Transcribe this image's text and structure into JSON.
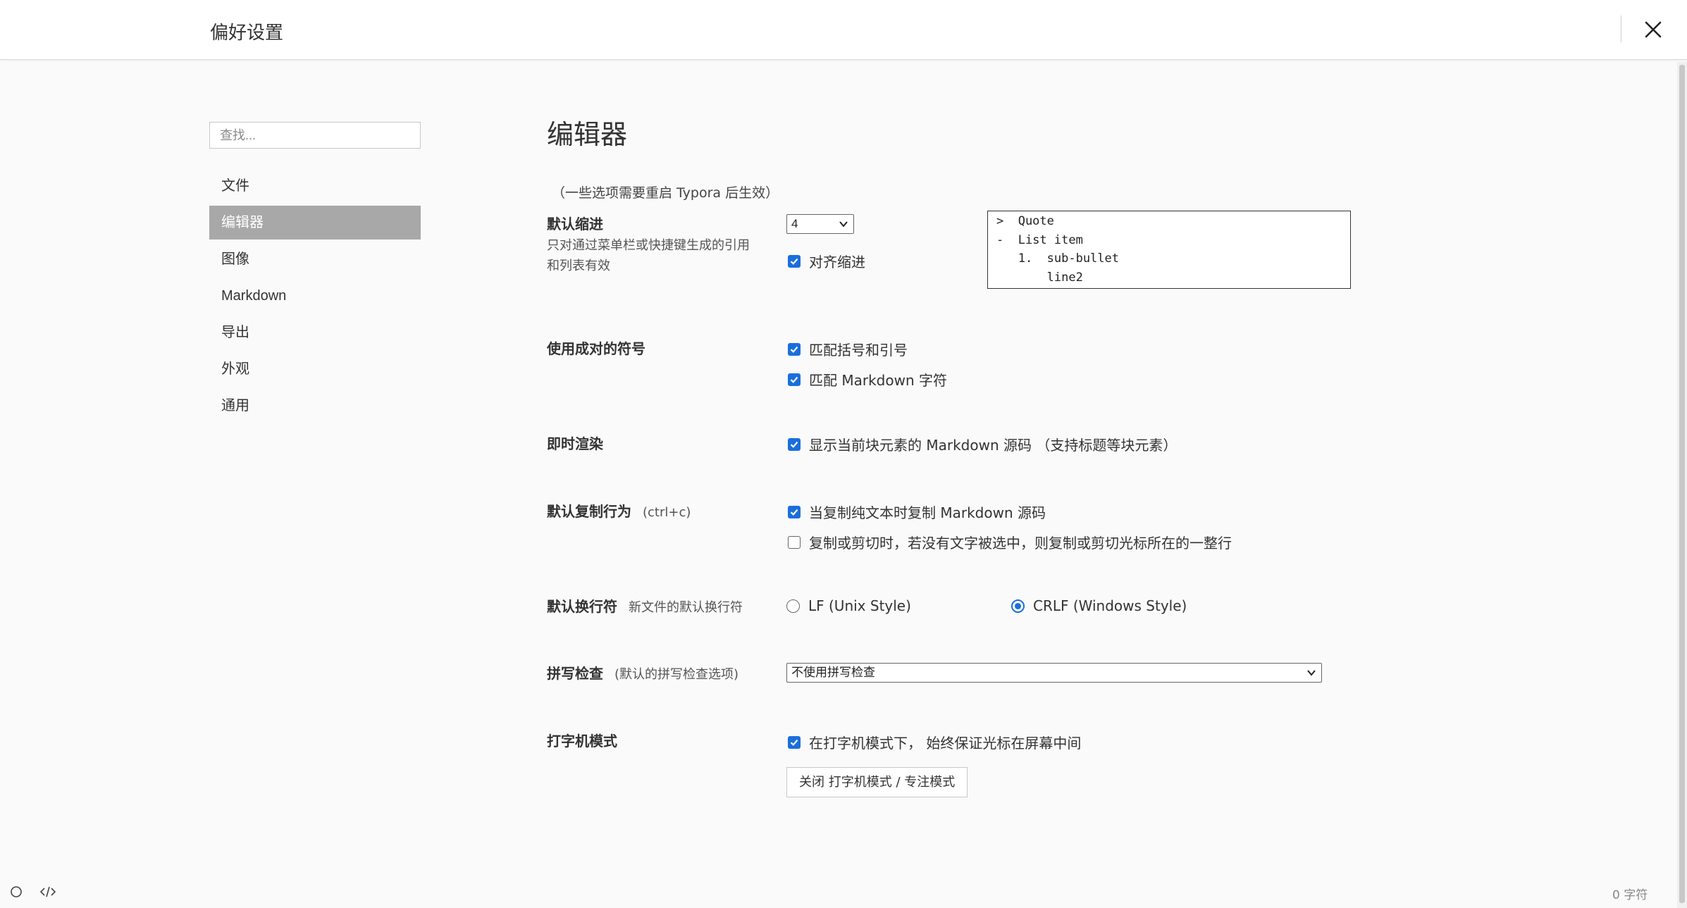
{
  "window": {
    "title": "偏好设置"
  },
  "sidebar": {
    "search_placeholder": "查找...",
    "items": [
      {
        "label": "文件"
      },
      {
        "label": "编辑器",
        "active": true
      },
      {
        "label": "图像"
      },
      {
        "label": "Markdown"
      },
      {
        "label": "导出"
      },
      {
        "label": "外观"
      },
      {
        "label": "通用"
      }
    ]
  },
  "main": {
    "title": "编辑器",
    "note": "（一些选项需要重启 Typora 后生效）",
    "indent": {
      "label": "默认缩进",
      "desc_line1": "只对通过菜单栏或快捷键生成的引用",
      "desc_line2": "和列表有效",
      "select_value": "4",
      "align_label": "对齐缩进",
      "align_checked": true,
      "preview": [
        ">  Quote",
        "-  List item",
        "   1.  sub-bullet",
        "       line2"
      ]
    },
    "pairs": {
      "label": "使用成对的符号",
      "opt1": "匹配括号和引号",
      "opt2": "匹配 Markdown 字符"
    },
    "live": {
      "label": "即时渲染",
      "opt1": "显示当前块元素的 Markdown 源码 （支持标题等块元素）"
    },
    "copy": {
      "label": "默认复制行为",
      "sub": "(ctrl+c)",
      "opt1": "当复制纯文本时复制 Markdown 源码",
      "opt2": "复制或剪切时，若没有文字被选中，则复制或剪切光标所在的一整行"
    },
    "newline": {
      "label": "默认换行符",
      "sub": "新文件的默认换行符",
      "opt_lf": "LF (Unix Style)",
      "opt_crlf": "CRLF (Windows Style)",
      "selected": "CRLF (Windows Style)"
    },
    "spell": {
      "label": "拼写检查",
      "sub": "(默认的拼写检查选项)",
      "select_value": "不使用拼写检查"
    },
    "typewriter": {
      "label": "打字机模式",
      "opt1": "在打字机模式下， 始终保证光标在屏幕中间",
      "button": "关闭 打字机模式 / 专注模式"
    }
  },
  "footer": {
    "char_count": "0 字符"
  },
  "colors": {
    "accent": "#1a6fdb",
    "active_nav": "#a8a8a8"
  }
}
